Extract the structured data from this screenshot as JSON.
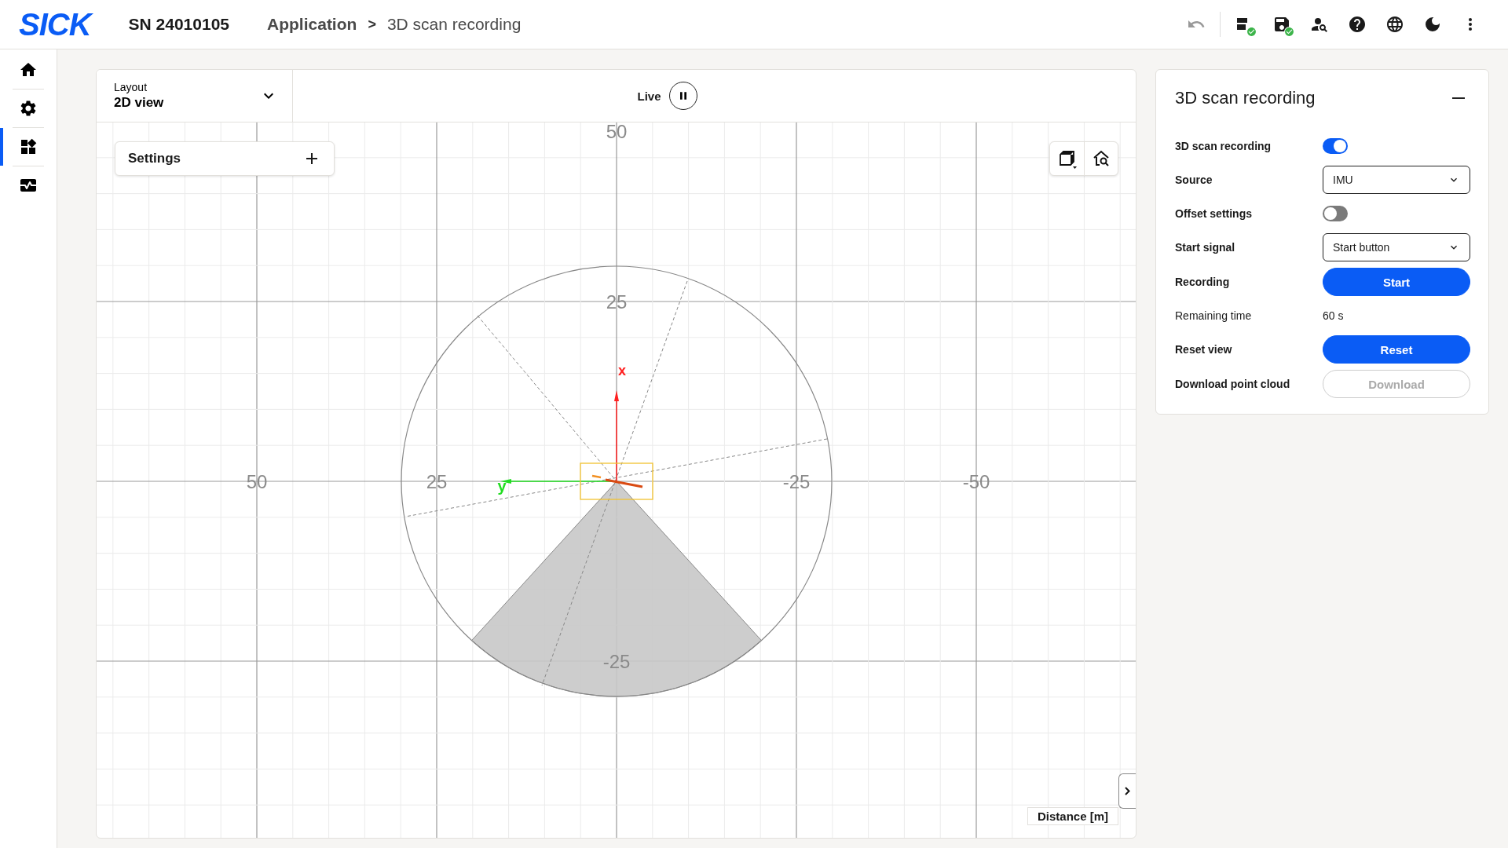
{
  "header": {
    "logo": "SICK",
    "serial": "SN 24010105",
    "breadcrumb": [
      {
        "label": "Application",
        "kind": "link"
      },
      {
        "label": "3D scan recording",
        "kind": "current"
      }
    ],
    "separator": ">"
  },
  "sidebar": {
    "items": [
      {
        "selected": false
      },
      {
        "selected": false
      },
      {
        "selected": true
      },
      {
        "selected": false
      }
    ]
  },
  "view": {
    "layout_label": "Layout",
    "layout_value": "2D view",
    "live_label": "Live",
    "settings_label": "Settings",
    "h_ticks": [
      "50",
      "25",
      "-25",
      "-50"
    ],
    "v_ticks": [
      "50",
      "25",
      "-25"
    ],
    "x_axis": "x",
    "y_axis": "y",
    "unit_label": "Distance [m]"
  },
  "panel": {
    "title": "3D scan recording",
    "rows": [
      {
        "label": "3D scan recording",
        "kind": "toggle",
        "on": true
      },
      {
        "label": "Source",
        "kind": "select",
        "value": "IMU"
      },
      {
        "label": "Offset settings",
        "kind": "toggle",
        "on": false
      },
      {
        "label": "Start signal",
        "kind": "select",
        "value": "Start button"
      },
      {
        "label": "Recording",
        "kind": "button",
        "value": "Start",
        "disabled": false
      },
      {
        "label": "Remaining time",
        "kind": "info",
        "value": "60 s"
      },
      {
        "label": "Reset view",
        "kind": "button",
        "value": "Reset",
        "disabled": false
      },
      {
        "label": "Download point cloud",
        "kind": "button",
        "value": "Download",
        "disabled": true
      }
    ]
  }
}
